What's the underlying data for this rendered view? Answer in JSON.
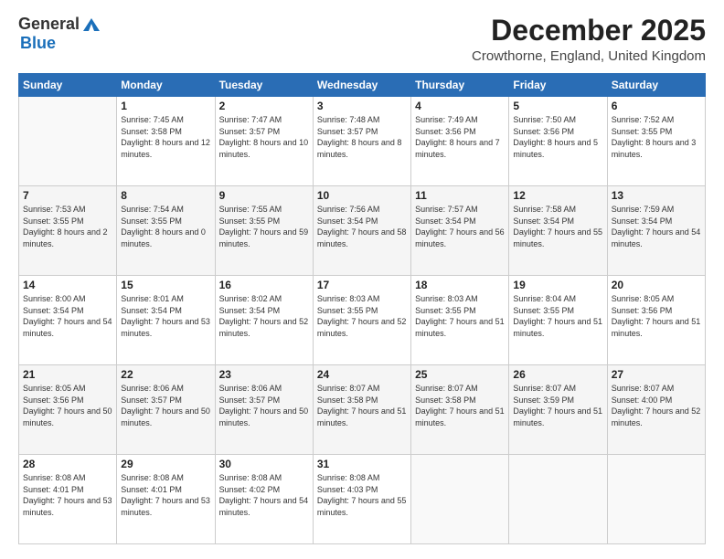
{
  "header": {
    "logo_general": "General",
    "logo_blue": "Blue",
    "month_title": "December 2025",
    "location": "Crowthorne, England, United Kingdom"
  },
  "calendar": {
    "days_of_week": [
      "Sunday",
      "Monday",
      "Tuesday",
      "Wednesday",
      "Thursday",
      "Friday",
      "Saturday"
    ],
    "weeks": [
      [
        {
          "num": "",
          "sunrise": "",
          "sunset": "",
          "daylight": ""
        },
        {
          "num": "1",
          "sunrise": "Sunrise: 7:45 AM",
          "sunset": "Sunset: 3:58 PM",
          "daylight": "Daylight: 8 hours and 12 minutes."
        },
        {
          "num": "2",
          "sunrise": "Sunrise: 7:47 AM",
          "sunset": "Sunset: 3:57 PM",
          "daylight": "Daylight: 8 hours and 10 minutes."
        },
        {
          "num": "3",
          "sunrise": "Sunrise: 7:48 AM",
          "sunset": "Sunset: 3:57 PM",
          "daylight": "Daylight: 8 hours and 8 minutes."
        },
        {
          "num": "4",
          "sunrise": "Sunrise: 7:49 AM",
          "sunset": "Sunset: 3:56 PM",
          "daylight": "Daylight: 8 hours and 7 minutes."
        },
        {
          "num": "5",
          "sunrise": "Sunrise: 7:50 AM",
          "sunset": "Sunset: 3:56 PM",
          "daylight": "Daylight: 8 hours and 5 minutes."
        },
        {
          "num": "6",
          "sunrise": "Sunrise: 7:52 AM",
          "sunset": "Sunset: 3:55 PM",
          "daylight": "Daylight: 8 hours and 3 minutes."
        }
      ],
      [
        {
          "num": "7",
          "sunrise": "Sunrise: 7:53 AM",
          "sunset": "Sunset: 3:55 PM",
          "daylight": "Daylight: 8 hours and 2 minutes."
        },
        {
          "num": "8",
          "sunrise": "Sunrise: 7:54 AM",
          "sunset": "Sunset: 3:55 PM",
          "daylight": "Daylight: 8 hours and 0 minutes."
        },
        {
          "num": "9",
          "sunrise": "Sunrise: 7:55 AM",
          "sunset": "Sunset: 3:55 PM",
          "daylight": "Daylight: 7 hours and 59 minutes."
        },
        {
          "num": "10",
          "sunrise": "Sunrise: 7:56 AM",
          "sunset": "Sunset: 3:54 PM",
          "daylight": "Daylight: 7 hours and 58 minutes."
        },
        {
          "num": "11",
          "sunrise": "Sunrise: 7:57 AM",
          "sunset": "Sunset: 3:54 PM",
          "daylight": "Daylight: 7 hours and 56 minutes."
        },
        {
          "num": "12",
          "sunrise": "Sunrise: 7:58 AM",
          "sunset": "Sunset: 3:54 PM",
          "daylight": "Daylight: 7 hours and 55 minutes."
        },
        {
          "num": "13",
          "sunrise": "Sunrise: 7:59 AM",
          "sunset": "Sunset: 3:54 PM",
          "daylight": "Daylight: 7 hours and 54 minutes."
        }
      ],
      [
        {
          "num": "14",
          "sunrise": "Sunrise: 8:00 AM",
          "sunset": "Sunset: 3:54 PM",
          "daylight": "Daylight: 7 hours and 54 minutes."
        },
        {
          "num": "15",
          "sunrise": "Sunrise: 8:01 AM",
          "sunset": "Sunset: 3:54 PM",
          "daylight": "Daylight: 7 hours and 53 minutes."
        },
        {
          "num": "16",
          "sunrise": "Sunrise: 8:02 AM",
          "sunset": "Sunset: 3:54 PM",
          "daylight": "Daylight: 7 hours and 52 minutes."
        },
        {
          "num": "17",
          "sunrise": "Sunrise: 8:03 AM",
          "sunset": "Sunset: 3:55 PM",
          "daylight": "Daylight: 7 hours and 52 minutes."
        },
        {
          "num": "18",
          "sunrise": "Sunrise: 8:03 AM",
          "sunset": "Sunset: 3:55 PM",
          "daylight": "Daylight: 7 hours and 51 minutes."
        },
        {
          "num": "19",
          "sunrise": "Sunrise: 8:04 AM",
          "sunset": "Sunset: 3:55 PM",
          "daylight": "Daylight: 7 hours and 51 minutes."
        },
        {
          "num": "20",
          "sunrise": "Sunrise: 8:05 AM",
          "sunset": "Sunset: 3:56 PM",
          "daylight": "Daylight: 7 hours and 51 minutes."
        }
      ],
      [
        {
          "num": "21",
          "sunrise": "Sunrise: 8:05 AM",
          "sunset": "Sunset: 3:56 PM",
          "daylight": "Daylight: 7 hours and 50 minutes."
        },
        {
          "num": "22",
          "sunrise": "Sunrise: 8:06 AM",
          "sunset": "Sunset: 3:57 PM",
          "daylight": "Daylight: 7 hours and 50 minutes."
        },
        {
          "num": "23",
          "sunrise": "Sunrise: 8:06 AM",
          "sunset": "Sunset: 3:57 PM",
          "daylight": "Daylight: 7 hours and 50 minutes."
        },
        {
          "num": "24",
          "sunrise": "Sunrise: 8:07 AM",
          "sunset": "Sunset: 3:58 PM",
          "daylight": "Daylight: 7 hours and 51 minutes."
        },
        {
          "num": "25",
          "sunrise": "Sunrise: 8:07 AM",
          "sunset": "Sunset: 3:58 PM",
          "daylight": "Daylight: 7 hours and 51 minutes."
        },
        {
          "num": "26",
          "sunrise": "Sunrise: 8:07 AM",
          "sunset": "Sunset: 3:59 PM",
          "daylight": "Daylight: 7 hours and 51 minutes."
        },
        {
          "num": "27",
          "sunrise": "Sunrise: 8:07 AM",
          "sunset": "Sunset: 4:00 PM",
          "daylight": "Daylight: 7 hours and 52 minutes."
        }
      ],
      [
        {
          "num": "28",
          "sunrise": "Sunrise: 8:08 AM",
          "sunset": "Sunset: 4:01 PM",
          "daylight": "Daylight: 7 hours and 53 minutes."
        },
        {
          "num": "29",
          "sunrise": "Sunrise: 8:08 AM",
          "sunset": "Sunset: 4:01 PM",
          "daylight": "Daylight: 7 hours and 53 minutes."
        },
        {
          "num": "30",
          "sunrise": "Sunrise: 8:08 AM",
          "sunset": "Sunset: 4:02 PM",
          "daylight": "Daylight: 7 hours and 54 minutes."
        },
        {
          "num": "31",
          "sunrise": "Sunrise: 8:08 AM",
          "sunset": "Sunset: 4:03 PM",
          "daylight": "Daylight: 7 hours and 55 minutes."
        },
        {
          "num": "",
          "sunrise": "",
          "sunset": "",
          "daylight": ""
        },
        {
          "num": "",
          "sunrise": "",
          "sunset": "",
          "daylight": ""
        },
        {
          "num": "",
          "sunrise": "",
          "sunset": "",
          "daylight": ""
        }
      ]
    ]
  }
}
